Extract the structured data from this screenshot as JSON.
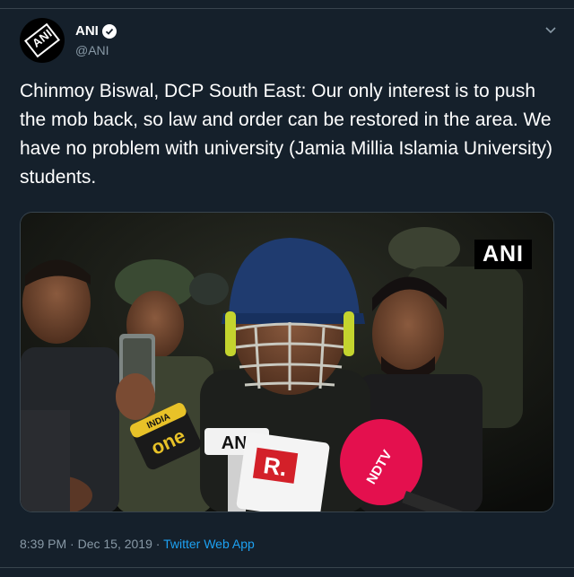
{
  "tweet": {
    "author": {
      "display_name": "ANI",
      "handle": "@ANI",
      "avatar_text": "ANI",
      "verified": true
    },
    "text": "Chinmoy Biswal, DCP South East: Our only interest is to push the mob back, so law and order can be restored in the area. We have no problem with university (Jamia Millia Islamia University) students.",
    "media": {
      "watermark": "ANI",
      "mic_labels": {
        "mic1_top": "INDIA",
        "mic1": "one",
        "mic2": "ANI",
        "mic3": "R.",
        "mic4": "NDTV"
      }
    },
    "time": "8:39 PM",
    "separator": " · ",
    "date": "Dec 15, 2019",
    "separator2": " · ",
    "source": "Twitter Web App"
  },
  "colors": {
    "background": "#15202b",
    "secondary_text": "#8899a6",
    "link": "#1da1f2",
    "border": "#38444d"
  },
  "icons": {
    "verified": "verified-badge-icon",
    "menu": "chevron-down-icon"
  }
}
